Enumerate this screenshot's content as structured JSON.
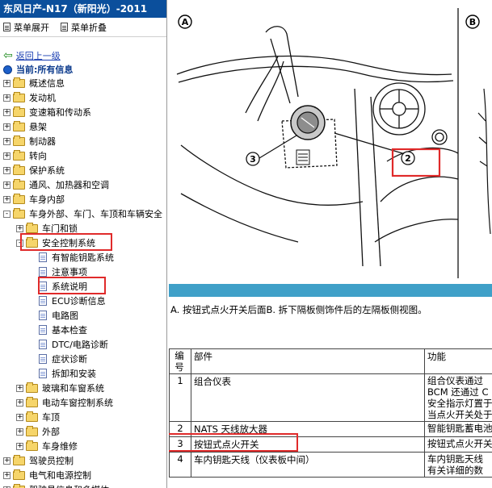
{
  "left_pane": {
    "title": "东风日产-N17（新阳光）-2011",
    "menu_expand": "菜单展开",
    "menu_collapse": "菜单折叠",
    "back_link": "返回上一级",
    "current_label": "当前:所有信息",
    "tree": [
      {
        "label": "概述信息",
        "level": 0,
        "kind": "folder",
        "toggle": "+"
      },
      {
        "label": "发动机",
        "level": 0,
        "kind": "folder",
        "toggle": "+"
      },
      {
        "label": "变速箱和传动系",
        "level": 0,
        "kind": "folder",
        "toggle": "+"
      },
      {
        "label": "悬架",
        "level": 0,
        "kind": "folder",
        "toggle": "+"
      },
      {
        "label": "制动器",
        "level": 0,
        "kind": "folder",
        "toggle": "+"
      },
      {
        "label": "转向",
        "level": 0,
        "kind": "folder",
        "toggle": "+"
      },
      {
        "label": "保护系统",
        "level": 0,
        "kind": "folder",
        "toggle": "+"
      },
      {
        "label": "通风、加热器和空调",
        "level": 0,
        "kind": "folder",
        "toggle": "+"
      },
      {
        "label": "车身内部",
        "level": 0,
        "kind": "folder",
        "toggle": "+"
      },
      {
        "label": "车身外部、车门、车顶和车辆安全",
        "level": 0,
        "kind": "folder",
        "toggle": "-"
      },
      {
        "label": "车门和锁",
        "level": 1,
        "kind": "folder",
        "toggle": "+"
      },
      {
        "label": "安全控制系统",
        "level": 1,
        "kind": "folder",
        "toggle": "-"
      },
      {
        "label": "有智能钥匙系统",
        "level": 2,
        "kind": "doc",
        "toggle": ""
      },
      {
        "label": "注意事项",
        "level": 2,
        "kind": "doc",
        "toggle": ""
      },
      {
        "label": "系统说明",
        "level": 2,
        "kind": "doc",
        "toggle": ""
      },
      {
        "label": "ECU诊断信息",
        "level": 2,
        "kind": "doc",
        "toggle": ""
      },
      {
        "label": "电路图",
        "level": 2,
        "kind": "doc",
        "toggle": ""
      },
      {
        "label": "基本检查",
        "level": 2,
        "kind": "doc",
        "toggle": ""
      },
      {
        "label": "DTC/电路诊断",
        "level": 2,
        "kind": "doc",
        "toggle": ""
      },
      {
        "label": "症状诊断",
        "level": 2,
        "kind": "doc",
        "toggle": ""
      },
      {
        "label": "拆卸和安装",
        "level": 2,
        "kind": "doc",
        "toggle": ""
      },
      {
        "label": "玻璃和车窗系统",
        "level": 1,
        "kind": "folder",
        "toggle": "+"
      },
      {
        "label": "电动车窗控制系统",
        "level": 1,
        "kind": "folder",
        "toggle": "+"
      },
      {
        "label": "车顶",
        "level": 1,
        "kind": "folder",
        "toggle": "+"
      },
      {
        "label": "外部",
        "level": 1,
        "kind": "folder",
        "toggle": "+"
      },
      {
        "label": "车身维修",
        "level": 1,
        "kind": "folder",
        "toggle": "+"
      },
      {
        "label": "驾驶员控制",
        "level": 0,
        "kind": "folder",
        "toggle": "+"
      },
      {
        "label": "电气和电源控制",
        "level": 0,
        "kind": "folder",
        "toggle": "+"
      },
      {
        "label": "驾驶员信息和多媒体",
        "level": 0,
        "kind": "folder",
        "toggle": "+"
      }
    ]
  },
  "figure": {
    "label_a": "A",
    "label_b": "B",
    "callout_3": "3",
    "callout_2": "2"
  },
  "caption": "A. 按钮式点火开关后面B. 拆下隔板侧饰件后的左隔板侧视图。",
  "table": {
    "headers": {
      "no": "编号",
      "part": "部件",
      "function": "功能"
    },
    "rows": [
      {
        "no": "1",
        "part": "组合仪表",
        "function": [
          "组合仪表通过",
          "BCM 还通过 C",
          "安全指示灯置于",
          "当点火开关处于"
        ]
      },
      {
        "no": "2",
        "part": "NATS 天线放大器",
        "function": [
          "智能钥匙蓄电池"
        ]
      },
      {
        "no": "3",
        "part": "按钮式点火开关",
        "function": [
          "按钮式点火开关"
        ]
      },
      {
        "no": "4",
        "part": "车内钥匙天线（仪表板中间）",
        "function": [
          "车内钥匙天线",
          "有关详细的数"
        ]
      }
    ]
  },
  "colors": {
    "title_bar": "#0b4f9c",
    "highlight_box": "#e02a2a",
    "caption_band": "#3fa0c8"
  }
}
